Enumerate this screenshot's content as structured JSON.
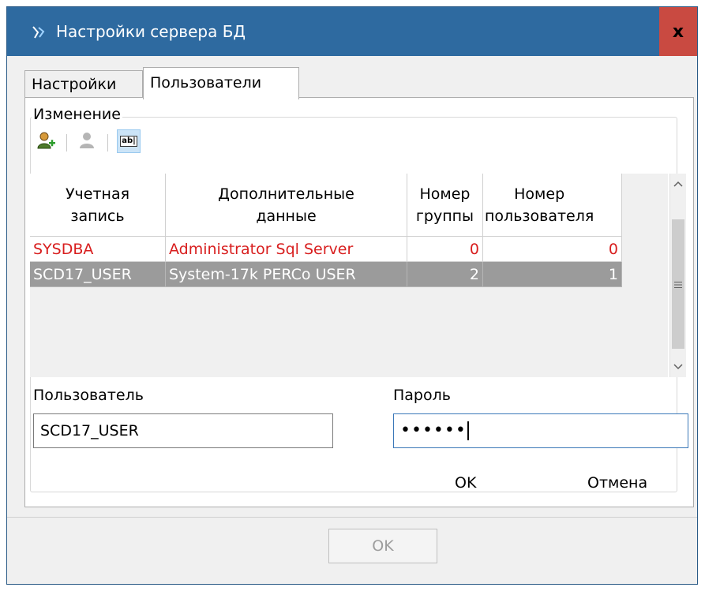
{
  "window": {
    "title": "Настройки сервера БД",
    "close_glyph": "x"
  },
  "tabs": [
    {
      "label": "Настройки",
      "active": false
    },
    {
      "label": "Пользователи",
      "active": true
    }
  ],
  "group": {
    "label": "Изменение"
  },
  "toolbar": {
    "buttons": [
      {
        "icon": "add-user-icon"
      },
      {
        "icon": "delete-user-icon",
        "disabled": true
      },
      {
        "icon": "rename-icon",
        "pressed": true,
        "text": "ab|"
      }
    ]
  },
  "grid": {
    "columns": [
      "Учетная\nзапись",
      "Дополнительные\nданные",
      "Номер\nгруппы",
      "Номер\nпользователя"
    ],
    "rows": [
      {
        "account": "SYSDBA",
        "info": "Administrator Sql Server",
        "group": "0",
        "user": "0",
        "state": "red"
      },
      {
        "account": "SCD17_USER",
        "info": "System-17k PERCo USER",
        "group": "2",
        "user": "1",
        "state": "selected"
      }
    ]
  },
  "form": {
    "user_label": "Пользователь",
    "user_value": "SCD17_USER",
    "password_label": "Пароль",
    "password_value": "••••••"
  },
  "actions": {
    "ok": "OK",
    "cancel": "Отмена"
  },
  "footer": {
    "ok": "OK"
  },
  "colors": {
    "titlebar": "#2e6aa0",
    "close": "#c94a41",
    "row_red": "#d81e1e",
    "row_selected": "#9b9b9b"
  }
}
